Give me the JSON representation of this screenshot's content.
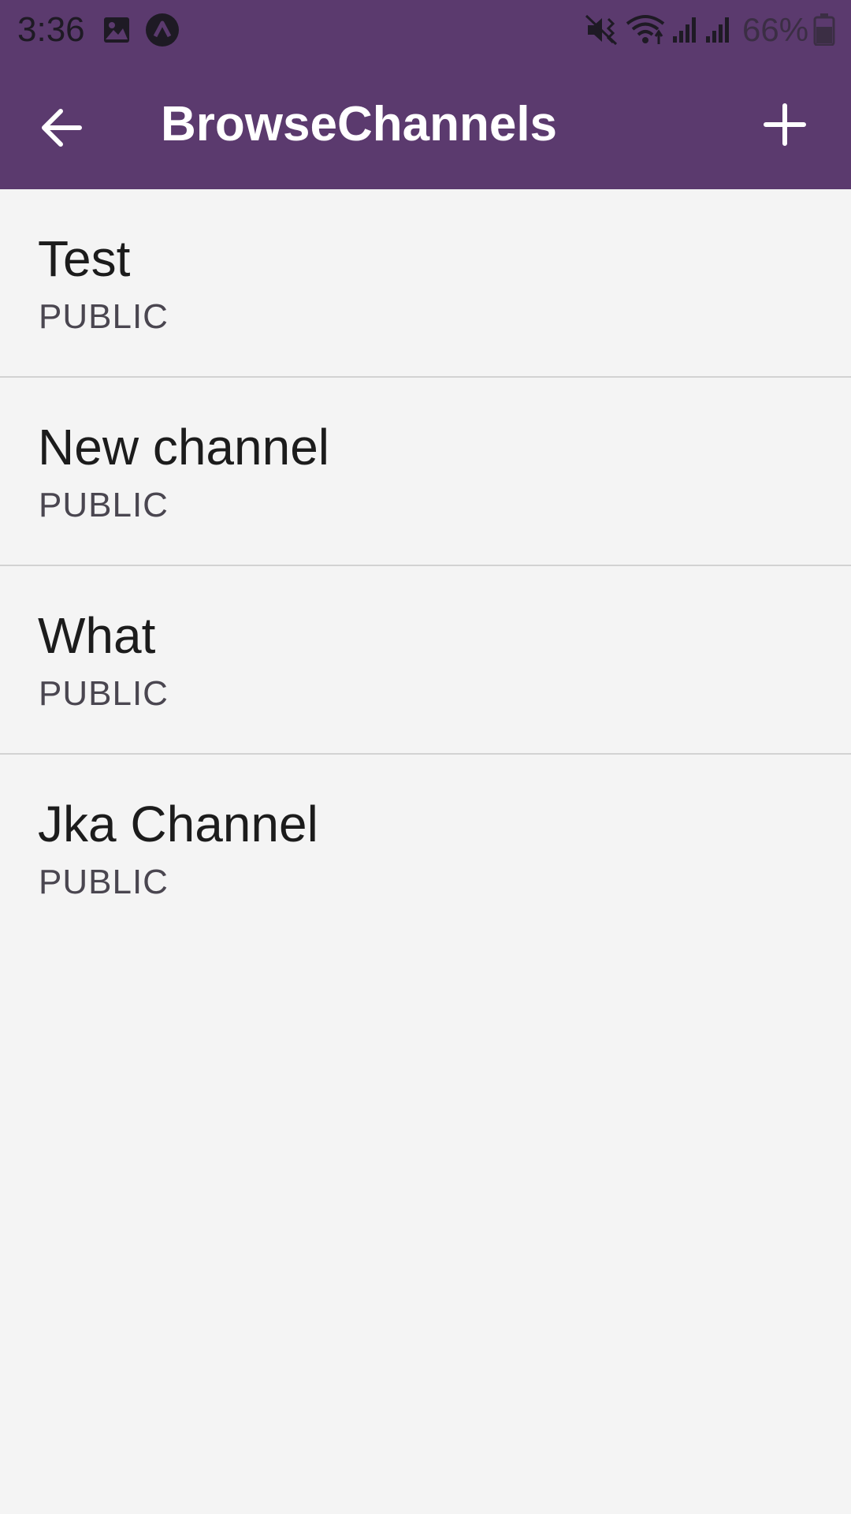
{
  "status_bar": {
    "time": "3:36",
    "battery_percent": "66%",
    "icons": [
      "image-icon",
      "app-notification-icon",
      "mute-vibrate-icon",
      "wifi-icon",
      "signal-icon",
      "signal-icon-2",
      "battery-icon"
    ]
  },
  "app_bar": {
    "title": "BrowseChannels",
    "back_icon": "arrow-left-icon",
    "add_icon": "plus-icon"
  },
  "channels": [
    {
      "name": "Test",
      "visibility": "PUBLIC"
    },
    {
      "name": "New channel",
      "visibility": "PUBLIC"
    },
    {
      "name": "What",
      "visibility": "PUBLIC"
    },
    {
      "name": "Jka Channel",
      "visibility": "PUBLIC"
    }
  ],
  "colors": {
    "app_bar": "#5b3a6e",
    "background": "#f4f4f4",
    "divider": "#d2d2d2",
    "title_text": "#ffffff",
    "primary_text": "#1c1c1c",
    "secondary_text": "#4a4650"
  }
}
